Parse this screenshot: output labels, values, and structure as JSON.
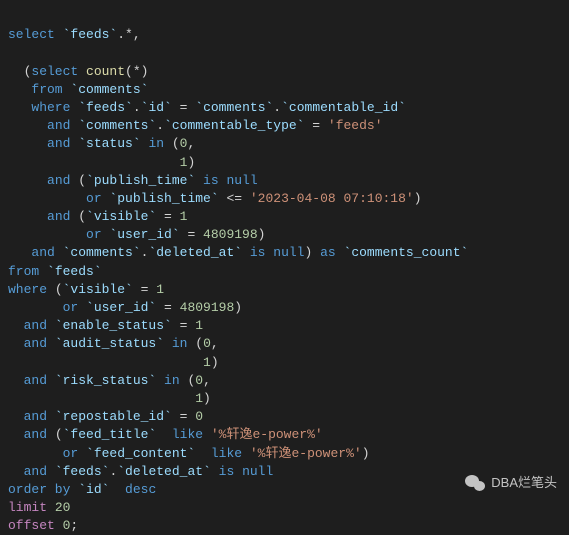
{
  "code": {
    "l1": {
      "a": "select",
      "b": "`feeds`",
      "c": ".*,"
    },
    "l3": {
      "a": "  (",
      "b": "select",
      "c": " count",
      "d": "(*)"
    },
    "l4": {
      "a": "   ",
      "b": "from",
      "c": " `comments`"
    },
    "l5": {
      "a": "   ",
      "b": "where",
      "c": " `feeds`",
      "d": ".",
      "e": "`id`",
      "f": " = ",
      "g": "`comments`",
      "h": ".",
      "i": "`commentable_id`"
    },
    "l6": {
      "a": "     ",
      "b": "and",
      "c": " `comments`",
      "d": ".",
      "e": "`commentable_type`",
      "f": " = ",
      "g": "'feeds'"
    },
    "l7": {
      "a": "     ",
      "b": "and",
      "c": " `status`",
      "d": " in",
      "e": " (",
      "f": "0",
      "g": ","
    },
    "l8": {
      "a": "                      ",
      "b": "1",
      "c": ")"
    },
    "l9": {
      "a": "     ",
      "b": "and",
      "c": " (",
      "d": "`publish_time`",
      "e": " is null"
    },
    "l10": {
      "a": "          ",
      "b": "or",
      "c": " `publish_time`",
      "d": " <= ",
      "e": "'2023-04-08 07:10:18'",
      "f": ")"
    },
    "l11": {
      "a": "     ",
      "b": "and",
      "c": " (",
      "d": "`visible`",
      "e": " = ",
      "f": "1"
    },
    "l12": {
      "a": "          ",
      "b": "or",
      "c": " `user_id`",
      "d": " = ",
      "e": "4809198",
      "f": ")"
    },
    "l13": {
      "a": "   ",
      "b": "and",
      "c": " `comments`",
      "d": ".",
      "e": "`deleted_at`",
      "f": " is null",
      "g": ") ",
      "h": "as",
      "i": " `comments_count`"
    },
    "l14": {
      "a": "from",
      "b": " `feeds`"
    },
    "l15": {
      "a": "where",
      "b": " (",
      "c": "`visible`",
      "d": " = ",
      "e": "1"
    },
    "l16": {
      "a": "       ",
      "b": "or",
      "c": " `user_id`",
      "d": " = ",
      "e": "4809198",
      "f": ")"
    },
    "l17": {
      "a": "  ",
      "b": "and",
      "c": " `enable_status`",
      "d": " = ",
      "e": "1"
    },
    "l18": {
      "a": "  ",
      "b": "and",
      "c": " `audit_status`",
      "d": " in",
      "e": " (",
      "f": "0",
      "g": ","
    },
    "l19": {
      "a": "                         ",
      "b": "1",
      "c": ")"
    },
    "l20": {
      "a": "  ",
      "b": "and",
      "c": " `risk_status`",
      "d": " in",
      "e": " (",
      "f": "0",
      "g": ","
    },
    "l21": {
      "a": "                        ",
      "b": "1",
      "c": ")"
    },
    "l22": {
      "a": "  ",
      "b": "and",
      "c": " `repostable_id`",
      "d": " = ",
      "e": "0"
    },
    "l23": {
      "a": "  ",
      "b": "and",
      "c": " (",
      "d": "`feed_title`",
      "e": "  like",
      "f": " '%轩逸e-power%'"
    },
    "l24": {
      "a": "       ",
      "b": "or",
      "c": " `feed_content`",
      "d": "  like",
      "e": " '%轩逸e-power%'",
      "f": ")"
    },
    "l25": {
      "a": "  ",
      "b": "and",
      "c": " `feeds`",
      "d": ".",
      "e": "`deleted_at`",
      "f": " is null"
    },
    "l26": {
      "a": "order by",
      "b": " `id`",
      "c": "  desc"
    },
    "l27": {
      "a": "limit",
      "b": " 20"
    },
    "l28": {
      "a": "offset",
      "b": " 0",
      "c": ";"
    }
  },
  "watermark": "DBA烂笔头"
}
